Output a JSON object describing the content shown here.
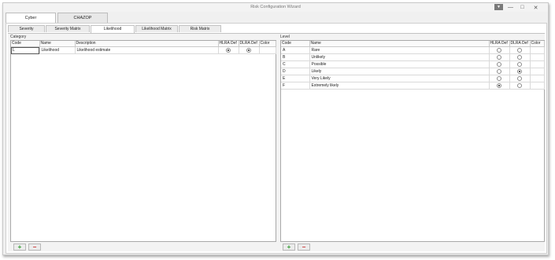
{
  "window": {
    "title": "Risk Configuration Wizard"
  },
  "outer_tabs": [
    {
      "label": "Cyber",
      "active": true
    },
    {
      "label": "CHAZOP",
      "active": false
    }
  ],
  "inner_tabs": [
    {
      "label": "Severity",
      "active": false
    },
    {
      "label": "Severity Matrix",
      "active": false
    },
    {
      "label": "Likelihood",
      "active": true
    },
    {
      "label": "Likelihood Matrix",
      "active": false
    },
    {
      "label": "Risk Matrix",
      "active": false
    }
  ],
  "category": {
    "label": "Category",
    "columns": [
      "Code",
      "Name",
      "Description",
      "HLRA Def",
      "DLRA Def",
      "Color"
    ],
    "rows": [
      {
        "code": "L",
        "name": "Likelihood",
        "description": "Likelihood estimate",
        "hlra": true,
        "dlra": true,
        "color": ""
      }
    ]
  },
  "level": {
    "label": "Level",
    "columns": [
      "Code",
      "Name",
      "HLRA Def",
      "DLRA Def",
      "Color"
    ],
    "rows": [
      {
        "code": "A",
        "name": "Rare",
        "hlra": false,
        "dlra": false,
        "color": ""
      },
      {
        "code": "B",
        "name": "Unlikely",
        "hlra": false,
        "dlra": false,
        "color": ""
      },
      {
        "code": "C",
        "name": "Possible",
        "hlra": false,
        "dlra": false,
        "color": ""
      },
      {
        "code": "D",
        "name": "Likely",
        "hlra": false,
        "dlra": true,
        "color": ""
      },
      {
        "code": "E",
        "name": "Very Likely",
        "hlra": false,
        "dlra": false,
        "color": ""
      },
      {
        "code": "F",
        "name": "Extremely likely",
        "hlra": true,
        "dlra": false,
        "color": ""
      }
    ]
  },
  "buttons": {
    "add": "+",
    "remove": "−"
  },
  "colors": {
    "add": "#2e9b2e",
    "remove": "#c93030"
  }
}
